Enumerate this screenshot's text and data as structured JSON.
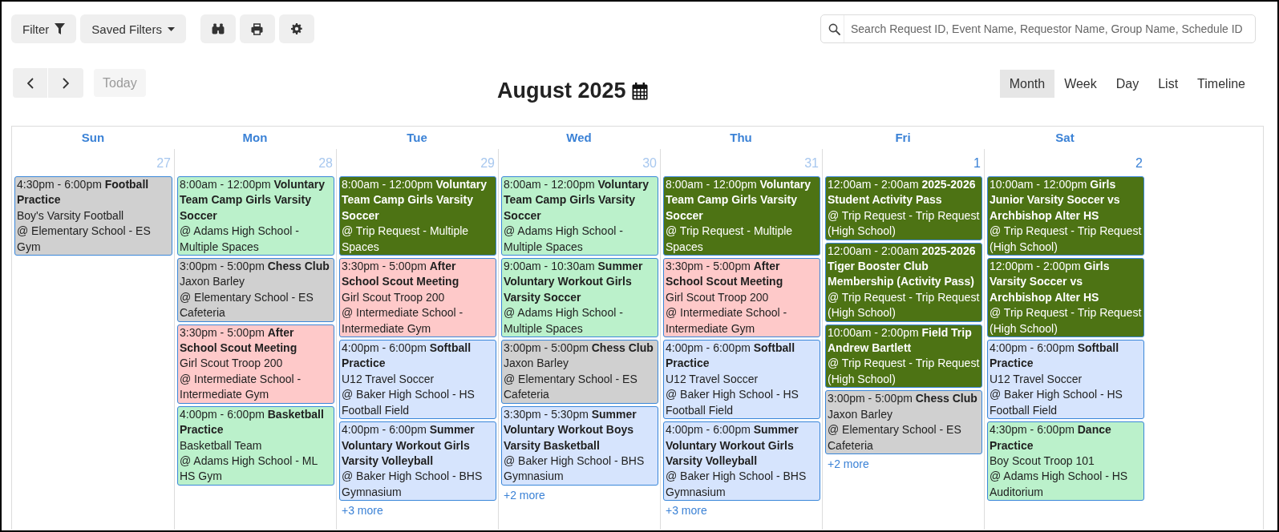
{
  "toolbar": {
    "filter_button": "Filter",
    "saved_filters_button": "Saved Filters"
  },
  "search": {
    "placeholder": "Search Request ID, Event Name, Requestor Name, Group Name, Schedule ID"
  },
  "navigation": {
    "today_button": {
      "label": "Today",
      "disabled": true
    }
  },
  "title": "August 2025",
  "views": [
    {
      "label": "Month",
      "selected": true
    },
    {
      "label": "Week",
      "selected": false
    },
    {
      "label": "Day",
      "selected": false
    },
    {
      "label": "List",
      "selected": false
    },
    {
      "label": "Timeline",
      "selected": false
    }
  ],
  "calendar": {
    "weekdays": [
      "Sun",
      "Mon",
      "Tue",
      "Wed",
      "Thu",
      "Fri",
      "Sat"
    ],
    "days": [
      {
        "date": "27",
        "other_month": true,
        "events": [
          {
            "heading": "4:30pm - 6:00pm **Football Practice**",
            "group": "Boy's Varsity Football",
            "location": "@ Elementary School - ES Gym",
            "color": "#d0d0d0"
          }
        ]
      },
      {
        "date": "28",
        "other_month": true,
        "events": [
          {
            "heading": "8:00am - 12:00pm **Voluntary Team Camp Girls Varsity Soccer**",
            "location": "@ Adams High School - Multiple Spaces",
            "color": "#bbf1cb"
          },
          {
            "heading": "3:00pm - 5:00pm **Chess Club**",
            "group": "Jaxon Barley",
            "location": "@ Elementary School - ES Cafeteria",
            "color": "#d0d0d0"
          },
          {
            "heading": "3:30pm - 5:00pm **After School Scout Meeting**",
            "group": "Girl Scout Troop 200",
            "location": "@ Intermediate School - Intermediate Gym",
            "color": "#fec9c9"
          },
          {
            "heading": "4:00pm - 6:00pm **Basketball Practice**",
            "group": "Basketball Team",
            "location": "@ Adams High School - ML HS Gym",
            "color": "#bbf1cb"
          }
        ]
      },
      {
        "date": "29",
        "other_month": true,
        "more": "+3 more",
        "events": [
          {
            "heading": "8:00am - 12:00pm **Voluntary Team Camp Girls Varsity Soccer**",
            "location": "@ Trip Request - Multiple Spaces",
            "color": "#4d7314"
          },
          {
            "heading": "3:30pm - 5:00pm **After School Scout Meeting**",
            "group": "Girl Scout Troop 200",
            "location": "@ Intermediate School - Intermediate Gym",
            "color": "#fec9c9"
          },
          {
            "heading": "4:00pm - 6:00pm **Softball Practice**",
            "group": "U12 Travel Soccer",
            "location": "@ Baker High School - HS Football Field",
            "color": "#d6e4fd"
          },
          {
            "heading": "4:00pm - 6:00pm **Summer Voluntary Workout Girls Varsity Volleyball**",
            "location": "@ Baker High School - BHS Gymnasium",
            "color": "#d6e4fd"
          }
        ]
      },
      {
        "date": "30",
        "other_month": true,
        "more": "+2 more",
        "events": [
          {
            "heading": "8:00am - 12:00pm **Voluntary Team Camp Girls Varsity Soccer**",
            "location": "@ Adams High School - Multiple Spaces",
            "color": "#bbf1cb"
          },
          {
            "heading": "9:00am - 10:30am **Summer Voluntary Workout Girls Varsity Soccer**",
            "location": "@ Adams High School - Multiple Spaces",
            "color": "#bbf1cb"
          },
          {
            "heading": "3:00pm - 5:00pm **Chess Club**",
            "group": "Jaxon Barley",
            "location": "@ Elementary School - ES Cafeteria",
            "color": "#d0d0d0"
          },
          {
            "heading": "3:30pm - 5:30pm **Summer Voluntary Workout Boys Varsity Basketball**",
            "location": "@ Baker High School - BHS Gymnasium",
            "color": "#d6e4fd"
          }
        ]
      },
      {
        "date": "31",
        "other_month": true,
        "more": "+3 more",
        "events": [
          {
            "heading": "8:00am - 12:00pm **Voluntary Team Camp Girls Varsity Soccer**",
            "location": "@ Trip Request - Multiple Spaces",
            "color": "#4d7314"
          },
          {
            "heading": "3:30pm - 5:00pm **After School Scout Meeting**",
            "group": "Girl Scout Troop 200",
            "location": "@ Intermediate School - Intermediate Gym",
            "color": "#fec9c9"
          },
          {
            "heading": "4:00pm - 6:00pm **Softball Practice**",
            "group": "U12 Travel Soccer",
            "location": "@ Baker High School - HS Football Field",
            "color": "#d6e4fd"
          },
          {
            "heading": "4:00pm - 6:00pm **Summer Voluntary Workout Girls Varsity Volleyball**",
            "location": "@ Baker High School - BHS Gymnasium",
            "color": "#d6e4fd"
          }
        ]
      },
      {
        "date": "1",
        "other_month": false,
        "more": "+2 more",
        "events": [
          {
            "heading": "12:00am - 2:00am **2025-2026 Student Activity Pass**",
            "location": "@ Trip Request - Trip Request (High School)",
            "color": "#4d7314"
          },
          {
            "heading": "12:00am - 2:00am **2025-2026 Tiger Booster Club Membership (Activity Pass)**",
            "location": "@ Trip Request - Trip Request (High School)",
            "color": "#4d7314"
          },
          {
            "heading": "10:00am - 2:00pm **Field Trip Andrew Bartlett**",
            "location": "@ Trip Request - Trip Request (High School)",
            "color": "#4d7314"
          },
          {
            "heading": "3:00pm - 5:00pm **Chess Club**",
            "group": "Jaxon Barley",
            "location": "@ Elementary School - ES Cafeteria",
            "color": "#d0d0d0"
          }
        ]
      },
      {
        "date": "2",
        "other_month": false,
        "events": [
          {
            "heading": "10:00am - 12:00pm **Girls Junior Varsity Soccer vs Archbishop Alter HS**",
            "location": "@ Trip Request - Trip Request (High School)",
            "color": "#4d7314"
          },
          {
            "heading": "12:00pm - 2:00pm **Girls Varsity Soccer vs Archbishop Alter HS**",
            "location": "@ Trip Request - Trip Request (High School)",
            "color": "#4d7314"
          },
          {
            "heading": "4:00pm - 6:00pm **Softball Practice**",
            "group": "U12 Travel Soccer",
            "location": "@ Baker High School - HS Football Field",
            "color": "#d6e4fd"
          },
          {
            "heading": "4:30pm - 6:00pm **Dance Practice**",
            "group": "Boy Scout Troop 101",
            "location": "@ Adams High School - HS Auditorium",
            "color": "#bbf1cb"
          }
        ]
      }
    ]
  }
}
